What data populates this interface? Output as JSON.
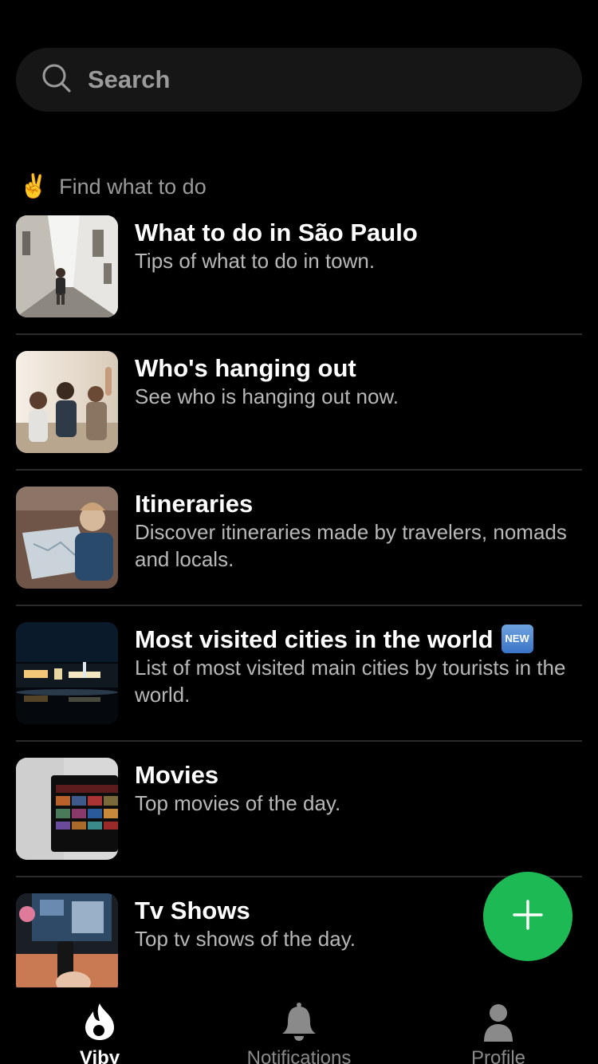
{
  "search": {
    "label": "Search"
  },
  "section": {
    "emoji": "✌️",
    "title": "Find what to do"
  },
  "items": [
    {
      "title": "What to do in São Paulo",
      "description": "Tips of what to do in town."
    },
    {
      "title": "Who's hanging out",
      "description": "See who is hanging out now."
    },
    {
      "title": "Itineraries",
      "description": "Discover itineraries made by travelers, nomads and locals."
    },
    {
      "title": "Most visited cities in the world",
      "badge": "NEW",
      "description": "List of most visited main cities by tourists in the world."
    },
    {
      "title": "Movies",
      "description": "Top movies of the day."
    },
    {
      "title": "Tv Shows",
      "description": "Top tv shows of the day."
    }
  ],
  "fab": {
    "icon": "plus-icon",
    "color": "#1db954"
  },
  "tabbar": {
    "tabs": [
      {
        "label": "Viby",
        "icon": "flame-icon",
        "active": true
      },
      {
        "label": "Notifications",
        "icon": "bell-icon",
        "active": false
      },
      {
        "label": "Profile",
        "icon": "person-icon",
        "active": false
      }
    ]
  }
}
